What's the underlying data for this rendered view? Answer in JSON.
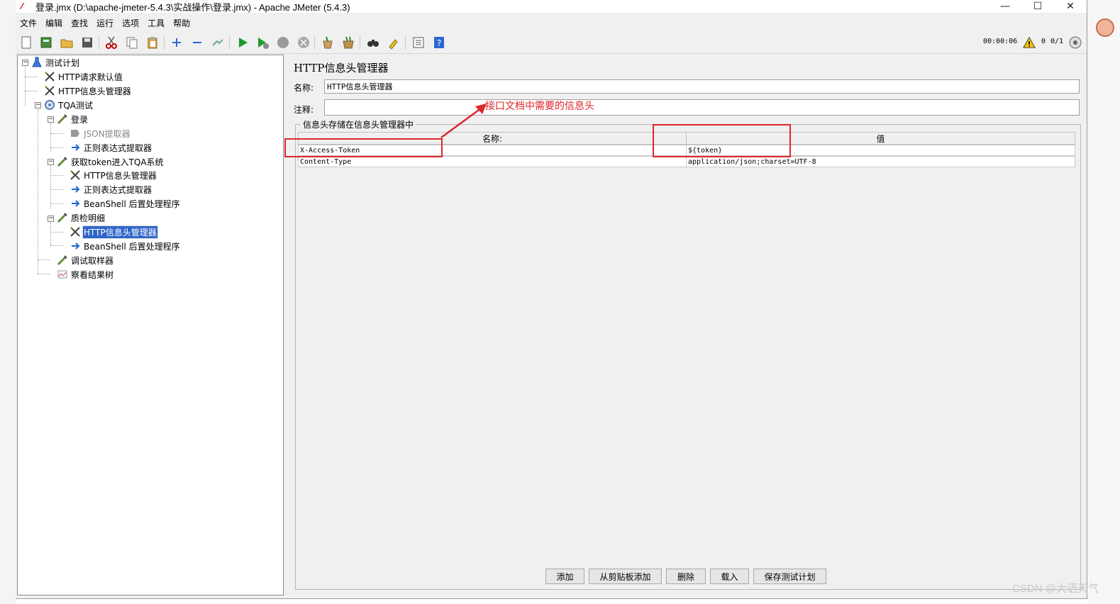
{
  "window": {
    "title": "登录.jmx (D:\\apache-jmeter-5.4.3\\实战操作\\登录.jmx) - Apache JMeter (5.4.3)",
    "minimize": "—",
    "maximize": "☐",
    "close": "✕"
  },
  "menu": [
    "文件",
    "编辑",
    "查找",
    "运行",
    "选项",
    "工具",
    "帮助"
  ],
  "toolbar": {
    "timer": "00:00:06",
    "warnings": "0",
    "threads": "0/1"
  },
  "tree": [
    {
      "label": "测试计划",
      "icon": "test-plan-icon"
    },
    {
      "label": "HTTP请求默认值",
      "icon": "config-icon"
    },
    {
      "label": "HTTP信息头管理器",
      "icon": "config-icon"
    },
    {
      "label": "TQA测试",
      "icon": "thread-group-icon"
    },
    {
      "label": "登录",
      "icon": "sampler-icon"
    },
    {
      "label": "JSON提取器",
      "icon": "disabled-extractor-icon"
    },
    {
      "label": "正则表达式提取器",
      "icon": "extractor-icon"
    },
    {
      "label": "获取token进入TQA系统",
      "icon": "sampler-icon"
    },
    {
      "label": "HTTP信息头管理器",
      "icon": "config-icon"
    },
    {
      "label": "正则表达式提取器",
      "icon": "extractor-icon"
    },
    {
      "label": "BeanShell 后置处理程序",
      "icon": "extractor-icon"
    },
    {
      "label": "质检明细",
      "icon": "sampler-icon"
    },
    {
      "label": "HTTP信息头管理器",
      "icon": "config-icon"
    },
    {
      "label": "BeanShell 后置处理程序",
      "icon": "extractor-icon"
    },
    {
      "label": "调试取样器",
      "icon": "sampler-icon"
    },
    {
      "label": "察看结果树",
      "icon": "listener-icon"
    }
  ],
  "panel": {
    "title": "HTTP信息头管理器",
    "name_label": "名称:",
    "name_value": "HTTP信息头管理器",
    "comment_label": "注释:",
    "comment_value": "",
    "group_title": "信息头存储在信息头管理器中",
    "col_name": "名称:",
    "col_value": "值",
    "rows": [
      {
        "name": "X-Access-Token",
        "value": "${token}"
      },
      {
        "name": "Content-Type",
        "value": "application/json;charset=UTF-8"
      }
    ],
    "buttons": {
      "add": "添加",
      "add_clipboard": "从剪贴板添加",
      "delete": "删除",
      "load": "载入",
      "save": "保存测试计划"
    }
  },
  "annotation": {
    "text": "接口文档中需要的信息头",
    "color": "#e0262a"
  },
  "watermark": "CSDN @大语天气"
}
